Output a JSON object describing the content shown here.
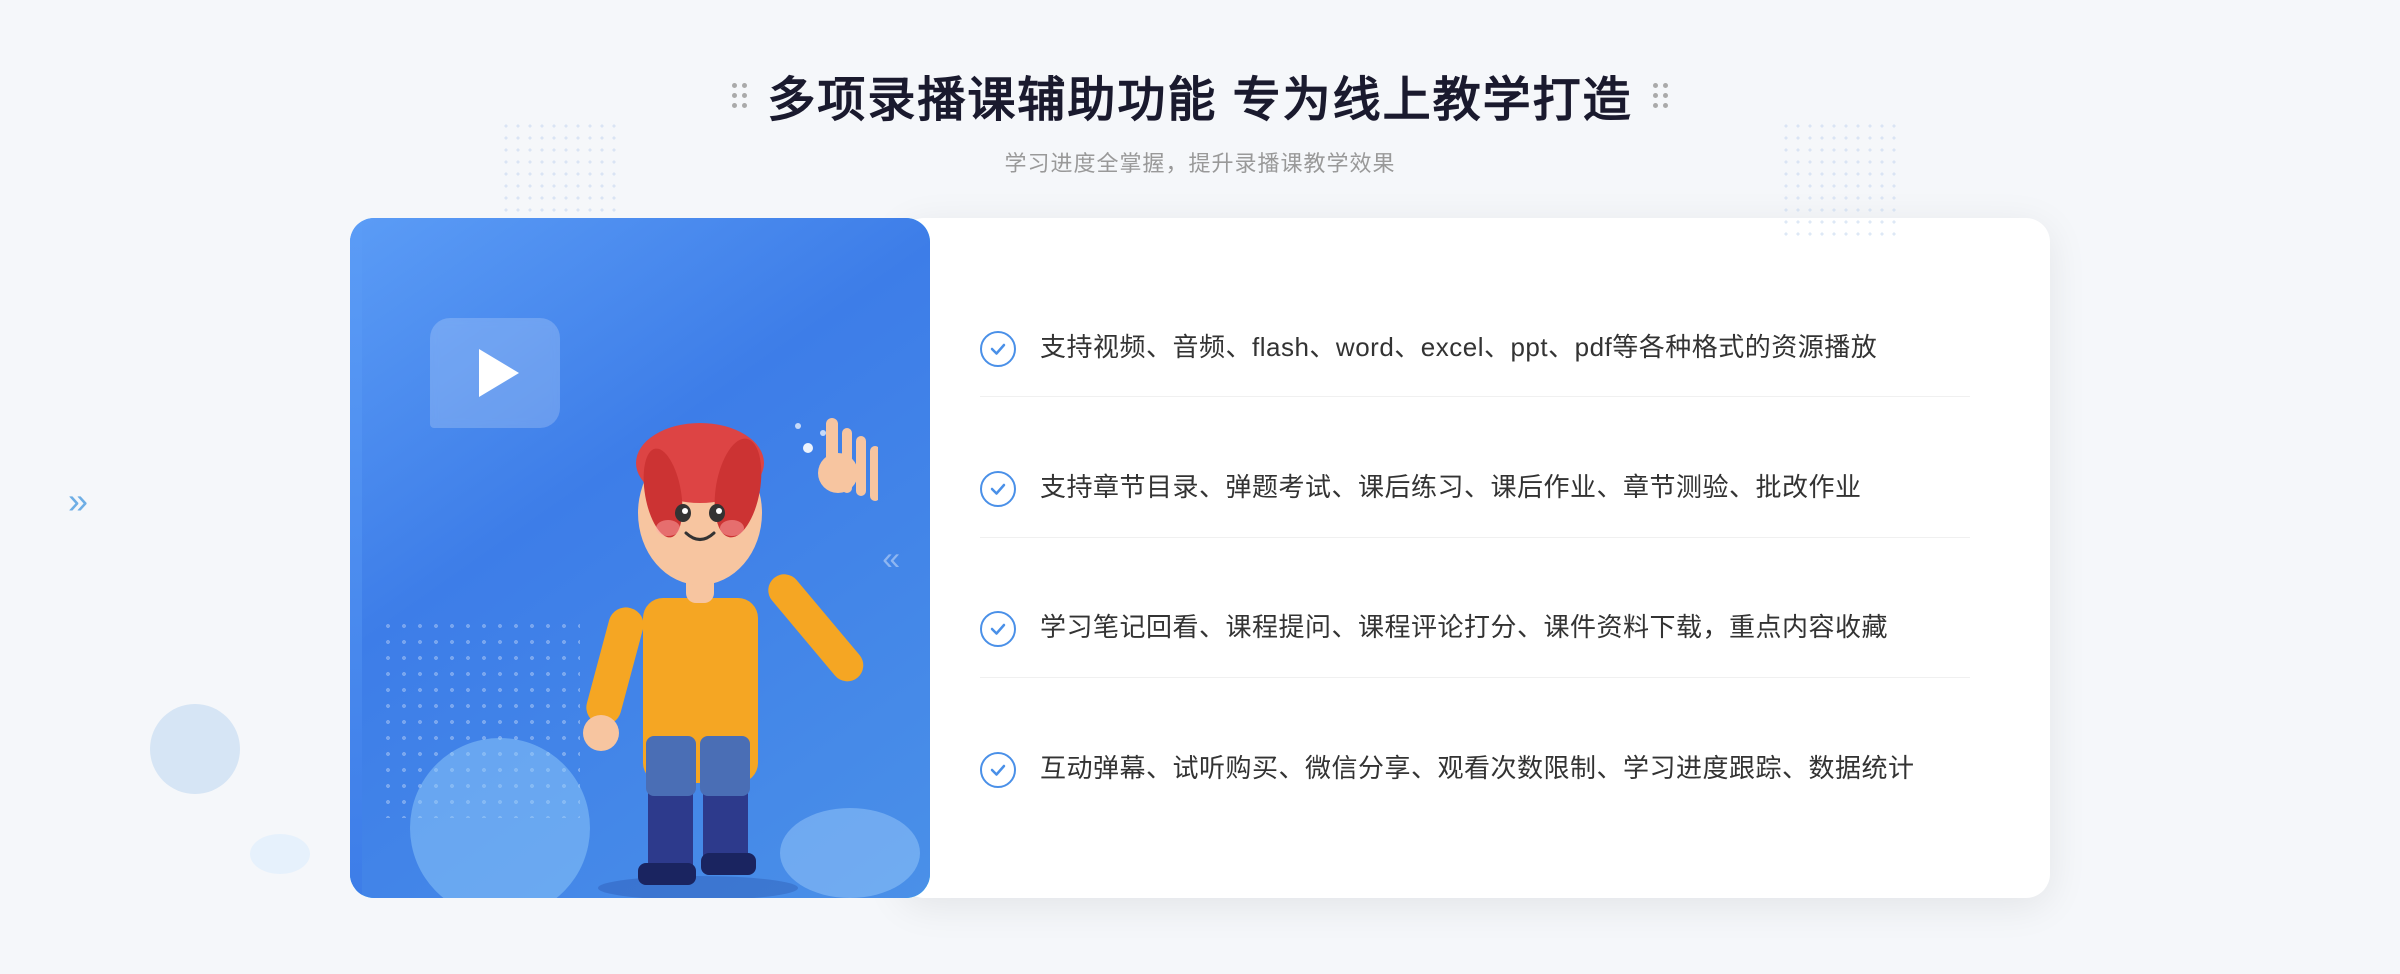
{
  "header": {
    "title": "多项录播课辅助功能 专为线上教学打造",
    "subtitle": "学习进度全掌握，提升录播课教学效果",
    "decorator_left": "⠿",
    "decorator_right": "⠿"
  },
  "features": [
    {
      "id": 1,
      "text": "支持视频、音频、flash、word、excel、ppt、pdf等各种格式的资源播放"
    },
    {
      "id": 2,
      "text": "支持章节目录、弹题考试、课后练习、课后作业、章节测验、批改作业"
    },
    {
      "id": 3,
      "text": "学习笔记回看、课程提问、课程评论打分、课件资料下载，重点内容收藏"
    },
    {
      "id": 4,
      "text": "互动弹幕、试听购买、微信分享、观看次数限制、学习进度跟踪、数据统计"
    }
  ],
  "arrow": "»",
  "colors": {
    "primary": "#4a90e8",
    "accent": "#5b9cf6",
    "text_dark": "#1a1a2e",
    "text_light": "#999",
    "bg": "#f5f7fa"
  }
}
